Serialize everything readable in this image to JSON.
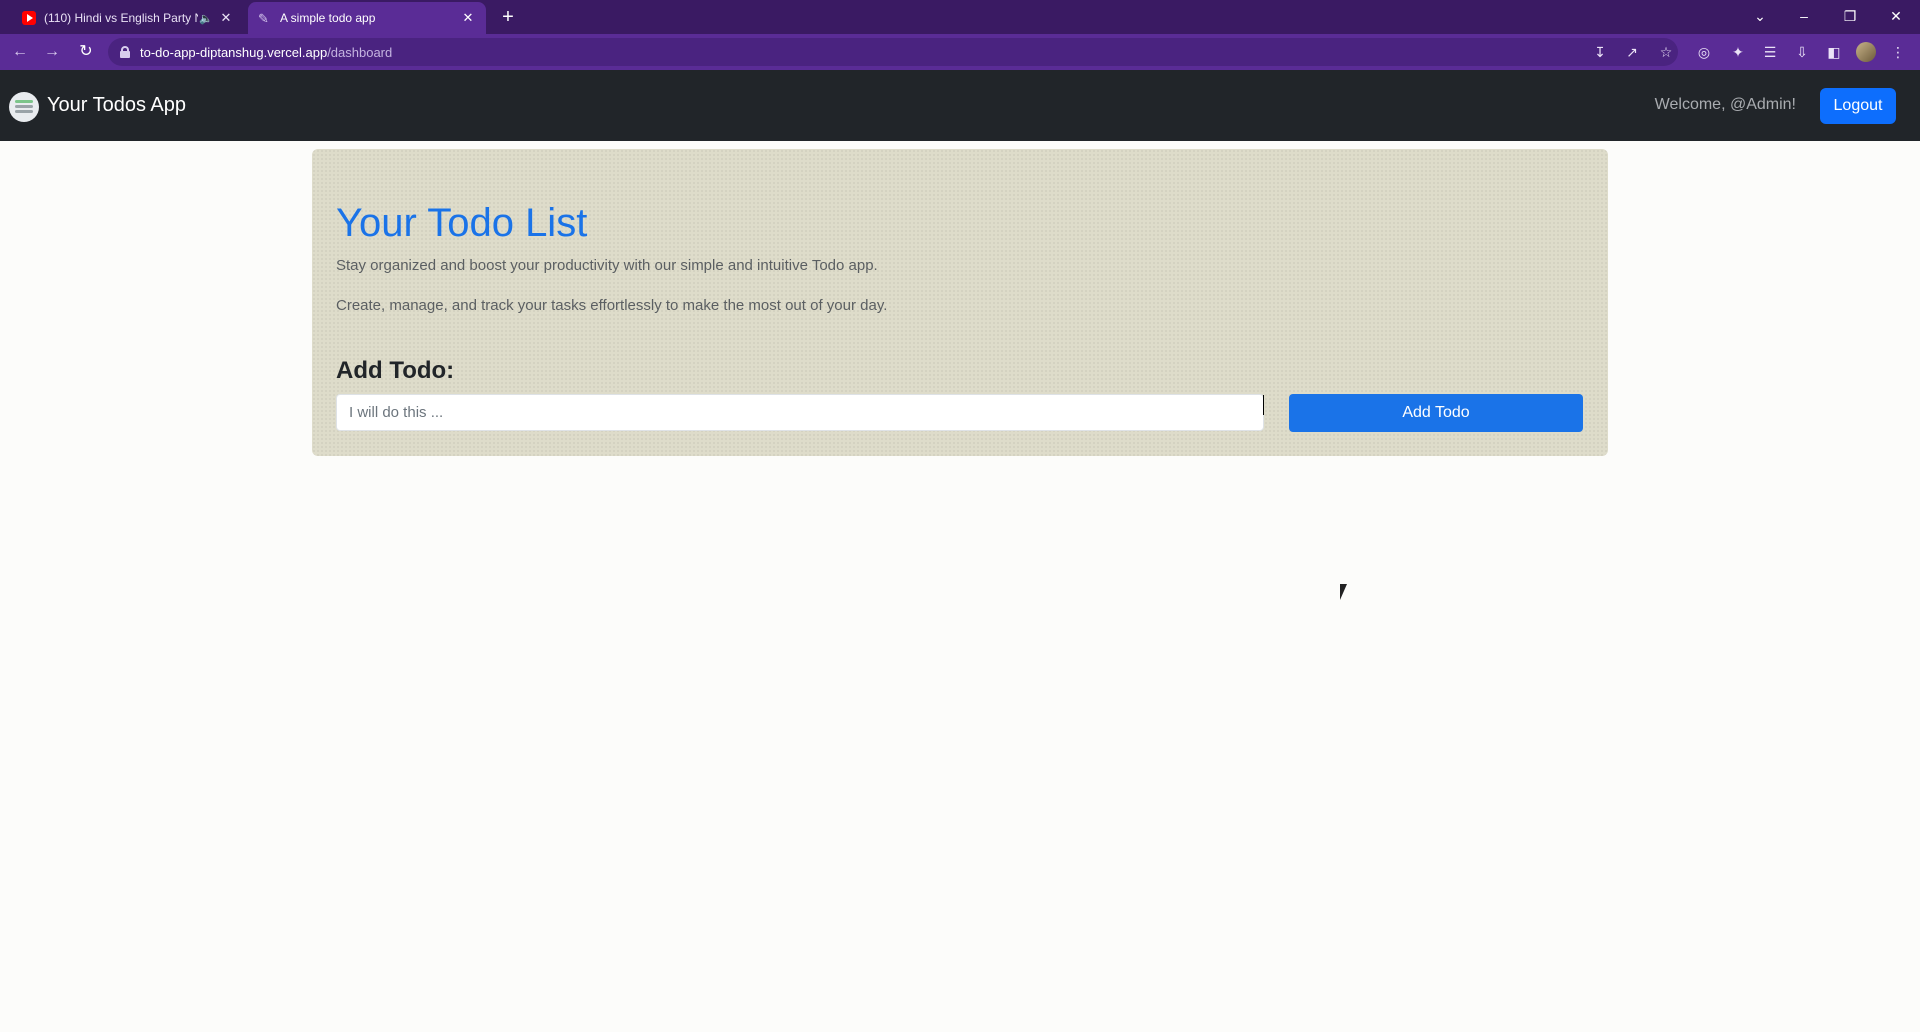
{
  "browser": {
    "tabs": [
      {
        "title": "(110) Hindi vs English Party N",
        "active": false
      },
      {
        "title": "A simple todo app",
        "active": true
      }
    ],
    "url_host": "to-do-app-diptanshug.vercel.app",
    "url_path": "/dashboard"
  },
  "navbar": {
    "brand": "Your Todos App",
    "welcome": "Welcome, @Admin!",
    "logout_label": "Logout"
  },
  "main": {
    "heading": "Your Todo List",
    "lead1": "Stay organized and boost your productivity with our simple and intuitive Todo app.",
    "lead2": "Create, manage, and track your tasks effortlessly to make the most out of your day.",
    "add_title": "Add Todo:",
    "input_placeholder": "I will do this ...",
    "add_button_label": "Add Todo"
  },
  "colors": {
    "navbar_bg": "#212529",
    "primary": "#0d6efd",
    "heading": "#1a73e8",
    "card_bg": "#dedcca"
  }
}
